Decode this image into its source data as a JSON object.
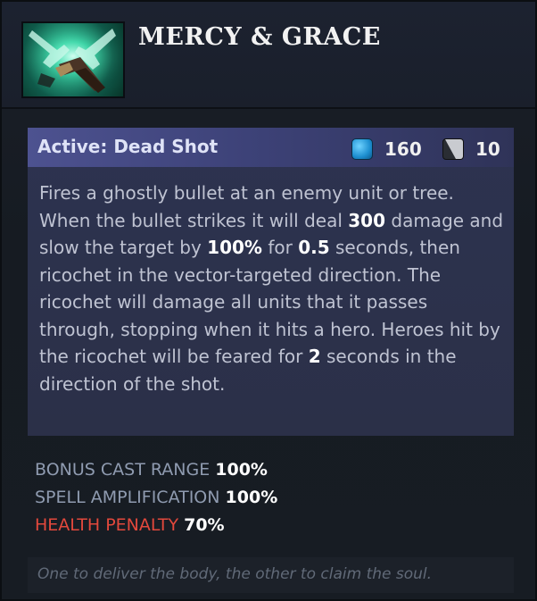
{
  "item": {
    "name": "MERCY & GRACE",
    "icon": "twin-pistols-icon"
  },
  "ability": {
    "title": "Active: Dead Shot",
    "mana_cost": "160",
    "cooldown": "10",
    "description_parts": {
      "p1": "Fires a ghostly bullet at an enemy unit or tree. When the bullet strikes it will deal ",
      "damage": "300",
      "p2": " damage and slow the target by ",
      "slow": "100%",
      "p3": " for ",
      "slow_duration": "0.5",
      "p4": " seconds, then ricochet in the vector-targeted direction. The ricochet will damage all units that it passes through, stopping when it hits a hero. Heroes hit by the ricochet will be feared for ",
      "fear_duration": "2",
      "p5": " seconds in the direction of the shot."
    }
  },
  "stats": [
    {
      "label": "BONUS CAST RANGE",
      "value": "100%"
    },
    {
      "label": "SPELL AMPLIFICATION",
      "value": "100%"
    },
    {
      "label": "HEALTH PENALTY",
      "value": "70%"
    }
  ],
  "lore": "One to deliver the body, the other to claim the soul.",
  "colors": {
    "mana": "#1d8fd0",
    "penalty": "#e2483c",
    "ability_header": "#4d5290"
  }
}
